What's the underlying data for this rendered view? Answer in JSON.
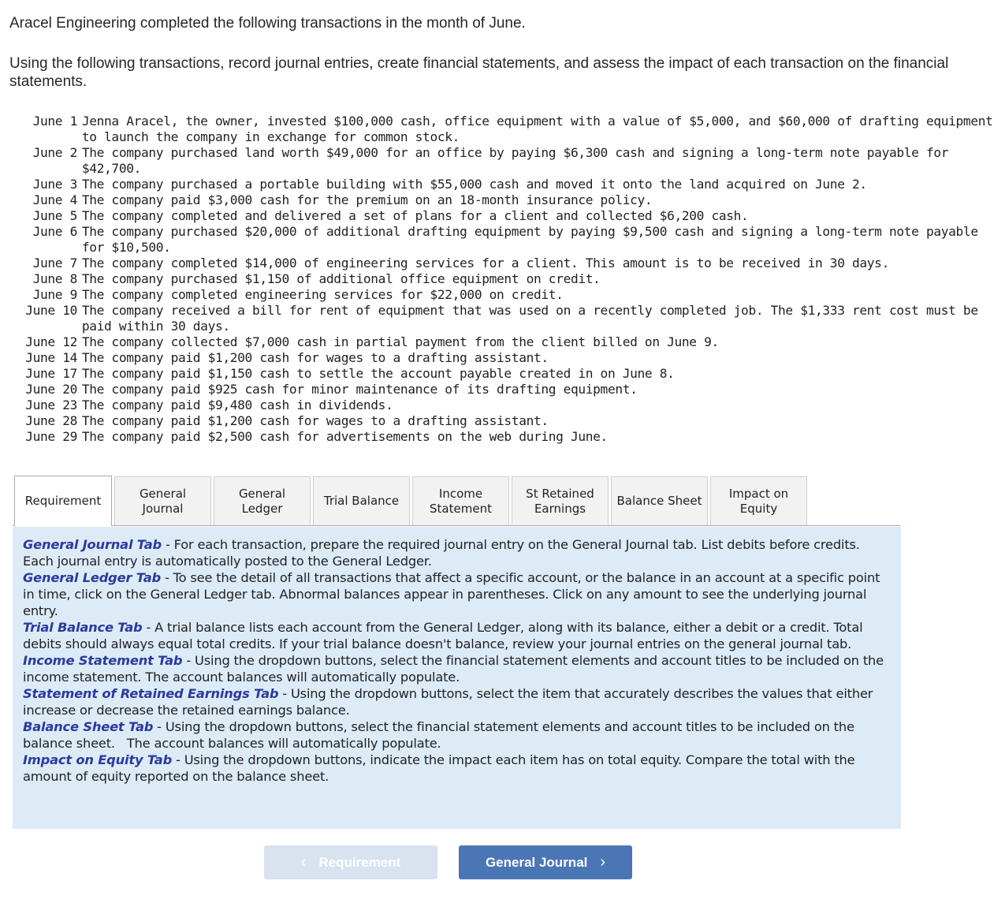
{
  "intro": {
    "line1": "Aracel Engineering completed the following transactions in the month of June.",
    "line2": "Using the following transactions, record journal entries, create financial statements, and assess the impact of each transaction on the financial statements."
  },
  "transactions": [
    {
      "date": "June 1",
      "text": "Jenna Aracel, the owner, invested $100,000 cash, office equipment with a value of $5,000, and $60,000 of drafting equipment to launch the company in exchange for common stock."
    },
    {
      "date": "June 2",
      "text": "The company purchased land worth $49,000 for an office by paying $6,300 cash and signing a long-term note payable for $42,700."
    },
    {
      "date": "June 3",
      "text": "The company purchased a portable building with $55,000 cash and moved it onto the land acquired on June 2."
    },
    {
      "date": "June 4",
      "text": "The company paid $3,000 cash for the premium on an 18-month insurance policy."
    },
    {
      "date": "June 5",
      "text": "The company completed and delivered a set of plans for a client and collected $6,200 cash."
    },
    {
      "date": "June 6",
      "text": "The company purchased $20,000 of additional drafting equipment by paying $9,500 cash and signing a long-term note payable for $10,500."
    },
    {
      "date": "June 7",
      "text": "The company completed $14,000 of engineering services for a client. This amount is to be received in 30 days."
    },
    {
      "date": "June 8",
      "text": "The company purchased $1,150 of additional office equipment on credit."
    },
    {
      "date": "June 9",
      "text": "The company completed engineering services for $22,000 on credit."
    },
    {
      "date": "June 10",
      "text": "The company received a bill for rent of equipment that was used on a recently completed job. The $1,333 rent cost must be paid within 30 days."
    },
    {
      "date": "June 12",
      "text": "The company collected $7,000 cash in partial payment from the client billed on June 9."
    },
    {
      "date": "June 14",
      "text": "The company paid $1,200 cash for wages to a drafting assistant."
    },
    {
      "date": "June 17",
      "text": "The company paid $1,150 cash to settle the account payable created in on June 8."
    },
    {
      "date": "June 20",
      "text": "The company paid $925 cash for minor maintenance of its drafting equipment."
    },
    {
      "date": "June 23",
      "text": "The company paid $9,480 cash in dividends."
    },
    {
      "date": "June 28",
      "text": "The company paid $1,200 cash for wages to a drafting assistant."
    },
    {
      "date": "June 29",
      "text": "The company paid $2,500 cash for advertisements on the web during June."
    }
  ],
  "tabs": [
    {
      "id": "requirement",
      "line1": "Requirement",
      "line2": "",
      "active": true
    },
    {
      "id": "general-journal",
      "line1": "General",
      "line2": "Journal",
      "active": false
    },
    {
      "id": "general-ledger",
      "line1": "General",
      "line2": "Ledger",
      "active": false
    },
    {
      "id": "trial-balance",
      "line1": "Trial Balance",
      "line2": "",
      "active": false
    },
    {
      "id": "income-statement",
      "line1": "Income",
      "line2": "Statement",
      "active": false
    },
    {
      "id": "st-retained-earnings",
      "line1": "St Retained",
      "line2": "Earnings",
      "active": false
    },
    {
      "id": "balance-sheet",
      "line1": "Balance Sheet",
      "line2": "",
      "active": false
    },
    {
      "id": "impact-on-equity",
      "line1": "Impact on",
      "line2": "Equity",
      "active": false
    }
  ],
  "requirements": [
    {
      "title": "General Journal Tab",
      "sep": " - ",
      "text": "For each transaction, prepare the required journal entry on the General Journal tab. List debits before credits. Each journal entry is automatically posted to the General Ledger."
    },
    {
      "title": "General Ledger Tab",
      "sep": " - ",
      "text": "To see the detail of all transactions that affect a specific account, or the balance in an account at a specific point in time, click on the General Ledger tab. Abnormal balances appear in parentheses. Click on any amount to see the underlying journal entry."
    },
    {
      "title": "Trial Balance Tab",
      "sep": " - ",
      "text": "A trial balance lists each account from the General Ledger, along with its balance, either a debit or a credit. Total debits should always equal total credits. If your trial balance doesn't balance, review your journal entries on the general journal tab."
    },
    {
      "title": "Income Statement Tab",
      "sep": " - ",
      "text": "Using the dropdown buttons, select the financial statement elements and account titles to be included on the income statement. The account balances will automatically populate."
    },
    {
      "title": "Statement of Retained Earnings Tab",
      "sep": " - ",
      "text": "Using the dropdown buttons, select the item that accurately describes the values that either increase or decrease the retained earnings balance."
    },
    {
      "title": "Balance Sheet Tab",
      "sep": " - ",
      "text": "Using the dropdown buttons, select the financial statement elements and account titles to be included on the balance sheet.   The account balances will automatically populate."
    },
    {
      "title": "Impact on Equity Tab",
      "sep": " - ",
      "text": "Using the dropdown buttons, indicate the impact each item has on total equity. Compare the total with the amount of equity reported on the balance sheet."
    }
  ],
  "navigation": {
    "prev_label": "Requirement",
    "prev_icon": "‹",
    "prev_enabled": false,
    "next_label": "General Journal",
    "next_icon": "›",
    "next_enabled": true
  },
  "colors": {
    "panel_bg": "#ddebf7",
    "keyword": "#2b3a9e",
    "next_button": "#4a76b6",
    "prev_button_disabled": "#d9e2ef"
  }
}
